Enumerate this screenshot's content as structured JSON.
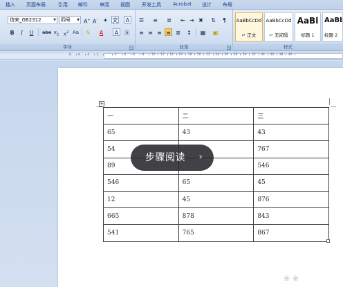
{
  "ribbon": {
    "tabs": [
      "插入",
      "页面布局",
      "引用",
      "邮件",
      "审阅",
      "视图",
      "开发工具",
      "Acrobat",
      "设计",
      "布局"
    ],
    "font_group": {
      "font_name": "仿宋_GB2312",
      "font_size": "四号",
      "label": "字体"
    },
    "paragraph_group": {
      "label": "段落"
    },
    "styles_group": {
      "label": "样式",
      "tiles": [
        {
          "preview": "AaBbCcDd",
          "name": "↵ 正文"
        },
        {
          "preview": "AaBbCcDd",
          "name": "↵ 无间隔"
        },
        {
          "preview": "AaBl",
          "name": "标题 1"
        },
        {
          "preview": "AaBb",
          "name": "标题 2"
        }
      ]
    }
  },
  "ruler": {
    "numbers": [
      "8",
      "6",
      "4",
      "2",
      "",
      "2",
      "4",
      "6",
      "8",
      "10",
      "12",
      "14",
      "16",
      "18",
      "20",
      "22",
      "24",
      "26",
      "28",
      "30",
      "32",
      "34",
      "36",
      "38",
      "40"
    ]
  },
  "table": {
    "rows": [
      [
        "一",
        "二",
        "三"
      ],
      [
        "65",
        "43",
        "43"
      ],
      [
        "54",
        "",
        "767"
      ],
      [
        "89",
        "",
        "546"
      ],
      [
        "546",
        "65",
        "45"
      ],
      [
        "12",
        "45",
        "876"
      ],
      [
        "665",
        "878",
        "843"
      ],
      [
        "541",
        "765",
        "867"
      ]
    ]
  },
  "overlay": {
    "label": "步骤阅读",
    "chevron": "›"
  },
  "colors": {
    "ribbon_bg": "#d2e0f1",
    "overlay_bg": "#28282c",
    "active_style_border": "#e6b34a"
  }
}
